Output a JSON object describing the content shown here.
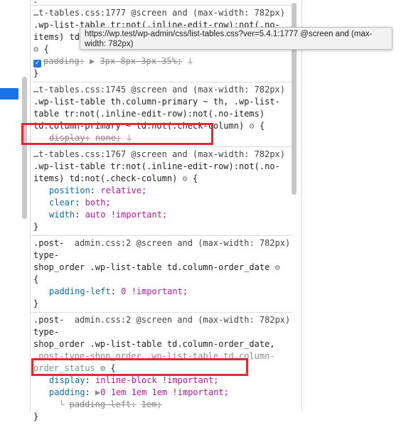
{
  "tooltip": {
    "text_line1": "https://wp.test/wp-admin/css/list-tables.css?ver=5.4.1:1777 @screen and (max-",
    "text_line2": "width: 782px)"
  },
  "rules": [
    {
      "source": "…t-tables.css:1777 @screen and (max-width: 782px)",
      "selector_line1": ".wp-list-table tr:not(.inline-edit-row):not(.no-",
      "selector_line2": "items) td",
      "open": "{",
      "decl_property": "padding",
      "decl_arrow": "▶",
      "decl_value": "3px 8px 3px 35%;",
      "close": "}"
    },
    {
      "source": "…t-tables.css:1745 @screen and (max-width: 782px)",
      "selector_line1": ".wp-list-table th.column-primary ~ th, .wp-list-",
      "selector_line2": "table tr:not(.inline-edit-row):not(.no-items)",
      "selector_line3": "td:not(.check-column)",
      "selector_line3_prefix": "td.column-primary ~",
      "open": "{",
      "decl_property": "display",
      "decl_value": "none;"
    },
    {
      "source": "…t-tables.css:1767 @screen and (max-width: 782px)",
      "selector_line1": ".wp-list-table tr:not(.inline-edit-row):not(.no-",
      "selector_line2": "items) td:not(.check-column)",
      "open": "{",
      "decls": [
        {
          "property": "position",
          "value": "relative;"
        },
        {
          "property": "clear",
          "value": "both;"
        },
        {
          "property": "width",
          "value": "auto !important;"
        }
      ],
      "close": "}"
    },
    {
      "selector_part1": ".post-",
      "source": "admin.css:2 @screen and (max-width: 782px)",
      "selector_line2": "type-",
      "selector_line3": "shop_order .wp-list-table td.column-order_date",
      "open": "{",
      "decl_property": "padding-left",
      "decl_value": "0 !important;",
      "close": "}"
    },
    {
      "selector_part1": ".post-",
      "source": "admin.css:2 @screen and (max-width: 782px)",
      "selector_line2": "type-",
      "selector_line3": "shop_order .wp-list-table td.column-order_date,",
      "selector_line4": ".post-type-shop_order .wp-list-table td.column-",
      "selector_line5": "order_status",
      "open": "{",
      "decl1_property": "display",
      "decl1_value": "inline-block !important;",
      "decl2_property": "padding",
      "decl2_arrow": "▶",
      "decl2_value": "0 1em 1em 1em !important;",
      "decl3_connector": "└",
      "decl3_property": "padding-left",
      "decl3_value": "1em;",
      "close": "}"
    }
  ],
  "colors": {
    "highlight": "#e02a2f",
    "property": "#0b6ea8",
    "value": "#b5179e",
    "checkbox": "#1a73e8"
  },
  "icons": {
    "gear": "gear-icon",
    "filter": "filter-icon",
    "checkbox": "checkbox-checked-icon"
  }
}
